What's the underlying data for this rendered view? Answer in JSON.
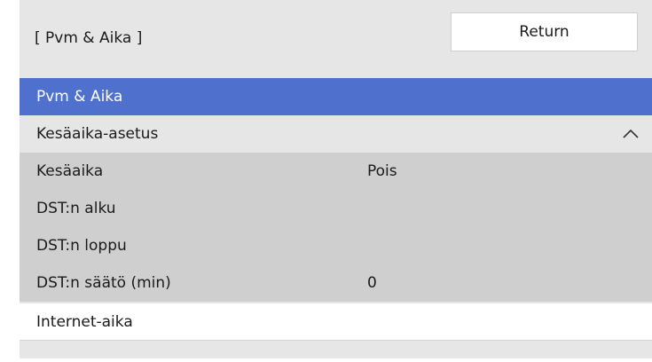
{
  "header": {
    "title": "[ Pvm & Aika ]",
    "return_label": "Return"
  },
  "menu": {
    "items": [
      {
        "label": "Pvm & Aika",
        "value": ""
      },
      {
        "label": "Kesäaika-asetus",
        "value": ""
      },
      {
        "label": "Kesäaika",
        "value": "Pois"
      },
      {
        "label": "DST:n alku",
        "value": ""
      },
      {
        "label": "DST:n loppu",
        "value": ""
      },
      {
        "label": "DST:n säätö (min)",
        "value": "0"
      },
      {
        "label": "Internet-aika",
        "value": ""
      }
    ]
  },
  "icons": {
    "expand_state": "chevron-up-icon"
  },
  "colors": {
    "selected": "#4f71cd",
    "group_bg": "#e6e6e6",
    "sub_bg": "#cfcfcf"
  }
}
